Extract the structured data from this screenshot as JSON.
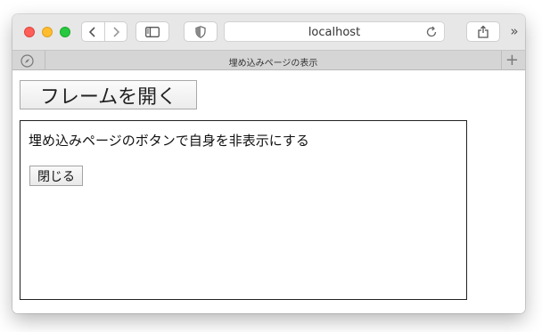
{
  "browser": {
    "address": "localhost",
    "tab_title": "埋め込みページの表示",
    "icons": {
      "back": "chevron-left-icon",
      "forward": "chevron-right-icon",
      "sidebar": "sidebar-icon",
      "privacy": "shield-icon",
      "reload": "reload-icon",
      "share": "share-icon",
      "more": "double-chevron-right-icon",
      "tab": "compass-icon",
      "new_tab": "plus-icon"
    },
    "new_tab_glyph": "+",
    "more_glyph": "»"
  },
  "page": {
    "open_button_label": "フレームを開く",
    "iframe": {
      "text": "埋め込みページのボタンで自身を非表示にする",
      "close_button_label": "閉じる"
    }
  }
}
